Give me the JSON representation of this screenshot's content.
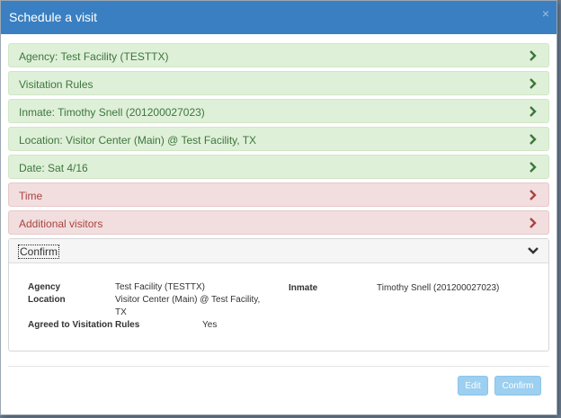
{
  "modal": {
    "title": "Schedule a visit",
    "close_symbol": "×"
  },
  "steps": [
    {
      "label": "Agency: Test Facility (TESTTX)",
      "status": "complete"
    },
    {
      "label": "Visitation Rules",
      "status": "complete"
    },
    {
      "label": "Inmate: Timothy Snell (201200027023)",
      "status": "complete"
    },
    {
      "label": "Location: Visitor Center (Main) @ Test Facility, TX",
      "status": "complete"
    },
    {
      "label": "Date: Sat 4/16",
      "status": "complete"
    },
    {
      "label": "Time",
      "status": "incomplete"
    },
    {
      "label": "Additional visitors",
      "status": "incomplete"
    }
  ],
  "confirm": {
    "header": "Confirm",
    "agency_label": "Agency",
    "agency_value": "Test Facility (TESTTX)",
    "location_label": "Location",
    "location_value_line1": "Visitor Center (Main) @ Test Facility,",
    "location_value_line2": "TX",
    "rules_label": "Agreed to Visitation Rules",
    "rules_value": "Yes",
    "inmate_label": "Inmate",
    "inmate_value": "Timothy Snell (201200027023)"
  },
  "footer": {
    "edit_label": "Edit",
    "confirm_label": "Confirm"
  },
  "colors": {
    "header_bg": "#3a7fc1",
    "complete_bg": "#dff0d8",
    "complete_text": "#3c763d",
    "incomplete_bg": "#f2dede",
    "incomplete_text": "#a94442",
    "button_bg": "#9ccff0"
  },
  "icons": {
    "step_chevron": "chevron-right-icon",
    "confirm_chevron": "chevron-down-icon",
    "close": "close-icon"
  }
}
